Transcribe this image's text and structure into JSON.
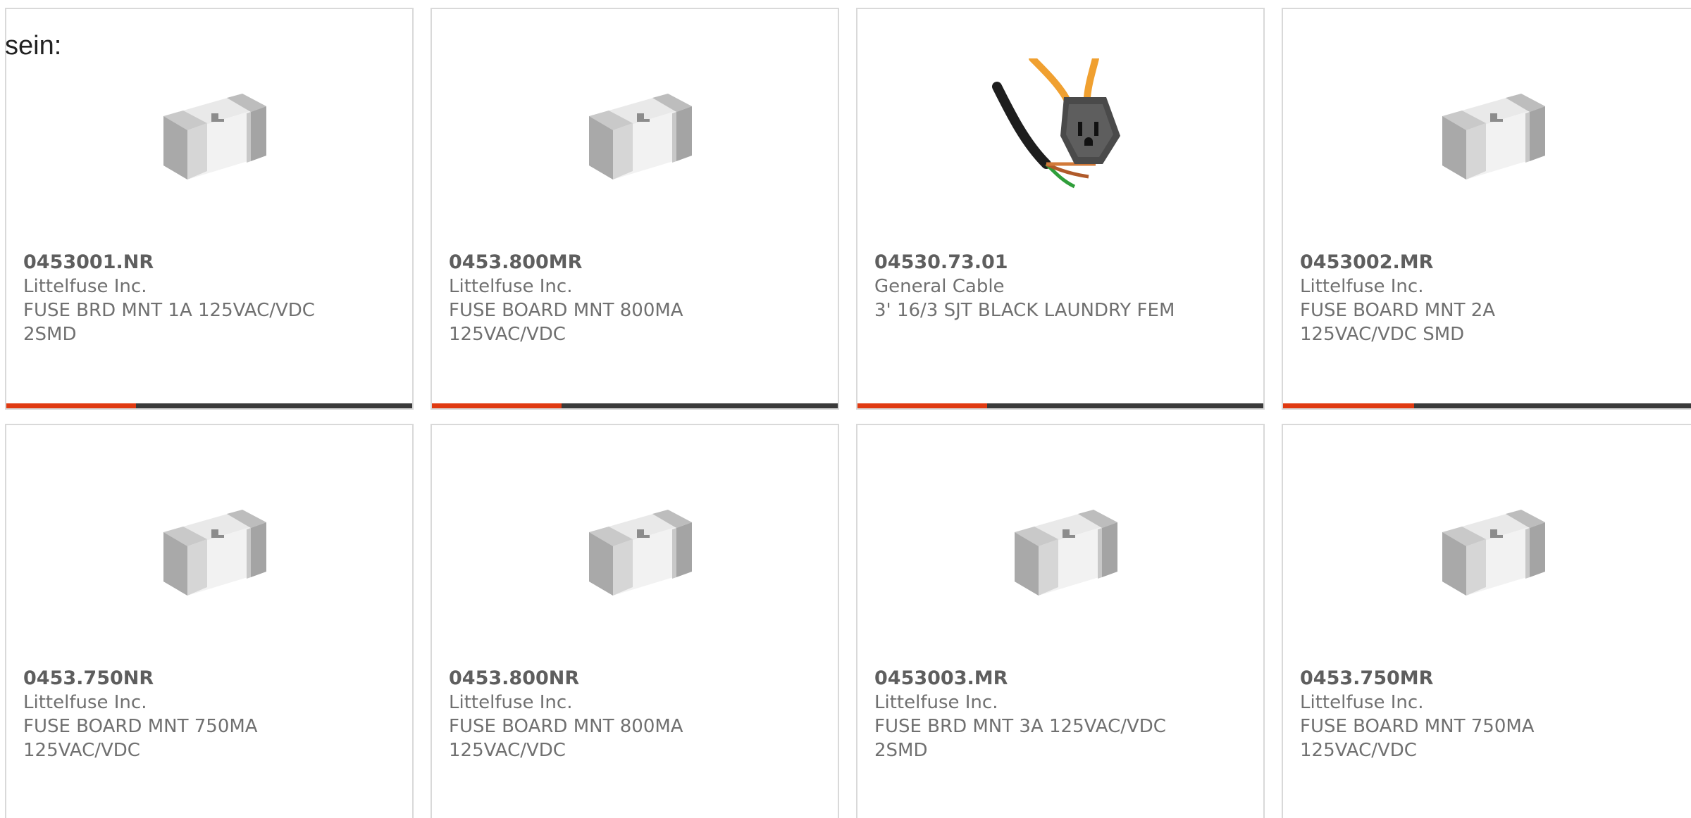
{
  "overlay_text": "sein:",
  "colors": {
    "accent": "#e03a12",
    "bar_track": "#3a3a3a",
    "card_border": "#d9d9d9",
    "text": "#707070"
  },
  "products": [
    {
      "part": "0453001.NR",
      "manufacturer": "Littelfuse Inc.",
      "description": "FUSE BRD MNT 1A 125VAC/VDC 2SMD",
      "image": "smd-fuse-icon",
      "progress": 0.32
    },
    {
      "part": "0453.800MR",
      "manufacturer": "Littelfuse Inc.",
      "description": "FUSE BOARD MNT 800MA 125VAC/VDC",
      "image": "smd-fuse-icon",
      "progress": 0.32
    },
    {
      "part": "04530.73.01",
      "manufacturer": "General Cable",
      "description": "3' 16/3 SJT BLACK LAUNDRY FEM",
      "image": "power-cord-icon",
      "progress": 0.32
    },
    {
      "part": "0453002.MR",
      "manufacturer": "Littelfuse Inc.",
      "description": "FUSE BOARD MNT 2A 125VAC/VDC SMD",
      "image": "smd-fuse-icon",
      "progress": 0.32
    },
    {
      "part": "0453.750NR",
      "manufacturer": "Littelfuse Inc.",
      "description": "FUSE BOARD MNT 750MA 125VAC/VDC",
      "image": "smd-fuse-icon"
    },
    {
      "part": "0453.800NR",
      "manufacturer": "Littelfuse Inc.",
      "description": "FUSE BOARD MNT 800MA 125VAC/VDC",
      "image": "smd-fuse-icon"
    },
    {
      "part": "0453003.MR",
      "manufacturer": "Littelfuse Inc.",
      "description": "FUSE BRD MNT 3A 125VAC/VDC 2SMD",
      "image": "smd-fuse-icon"
    },
    {
      "part": "0453.750MR",
      "manufacturer": "Littelfuse Inc.",
      "description": "FUSE BOARD MNT 750MA 125VAC/VDC",
      "image": "smd-fuse-icon"
    }
  ]
}
